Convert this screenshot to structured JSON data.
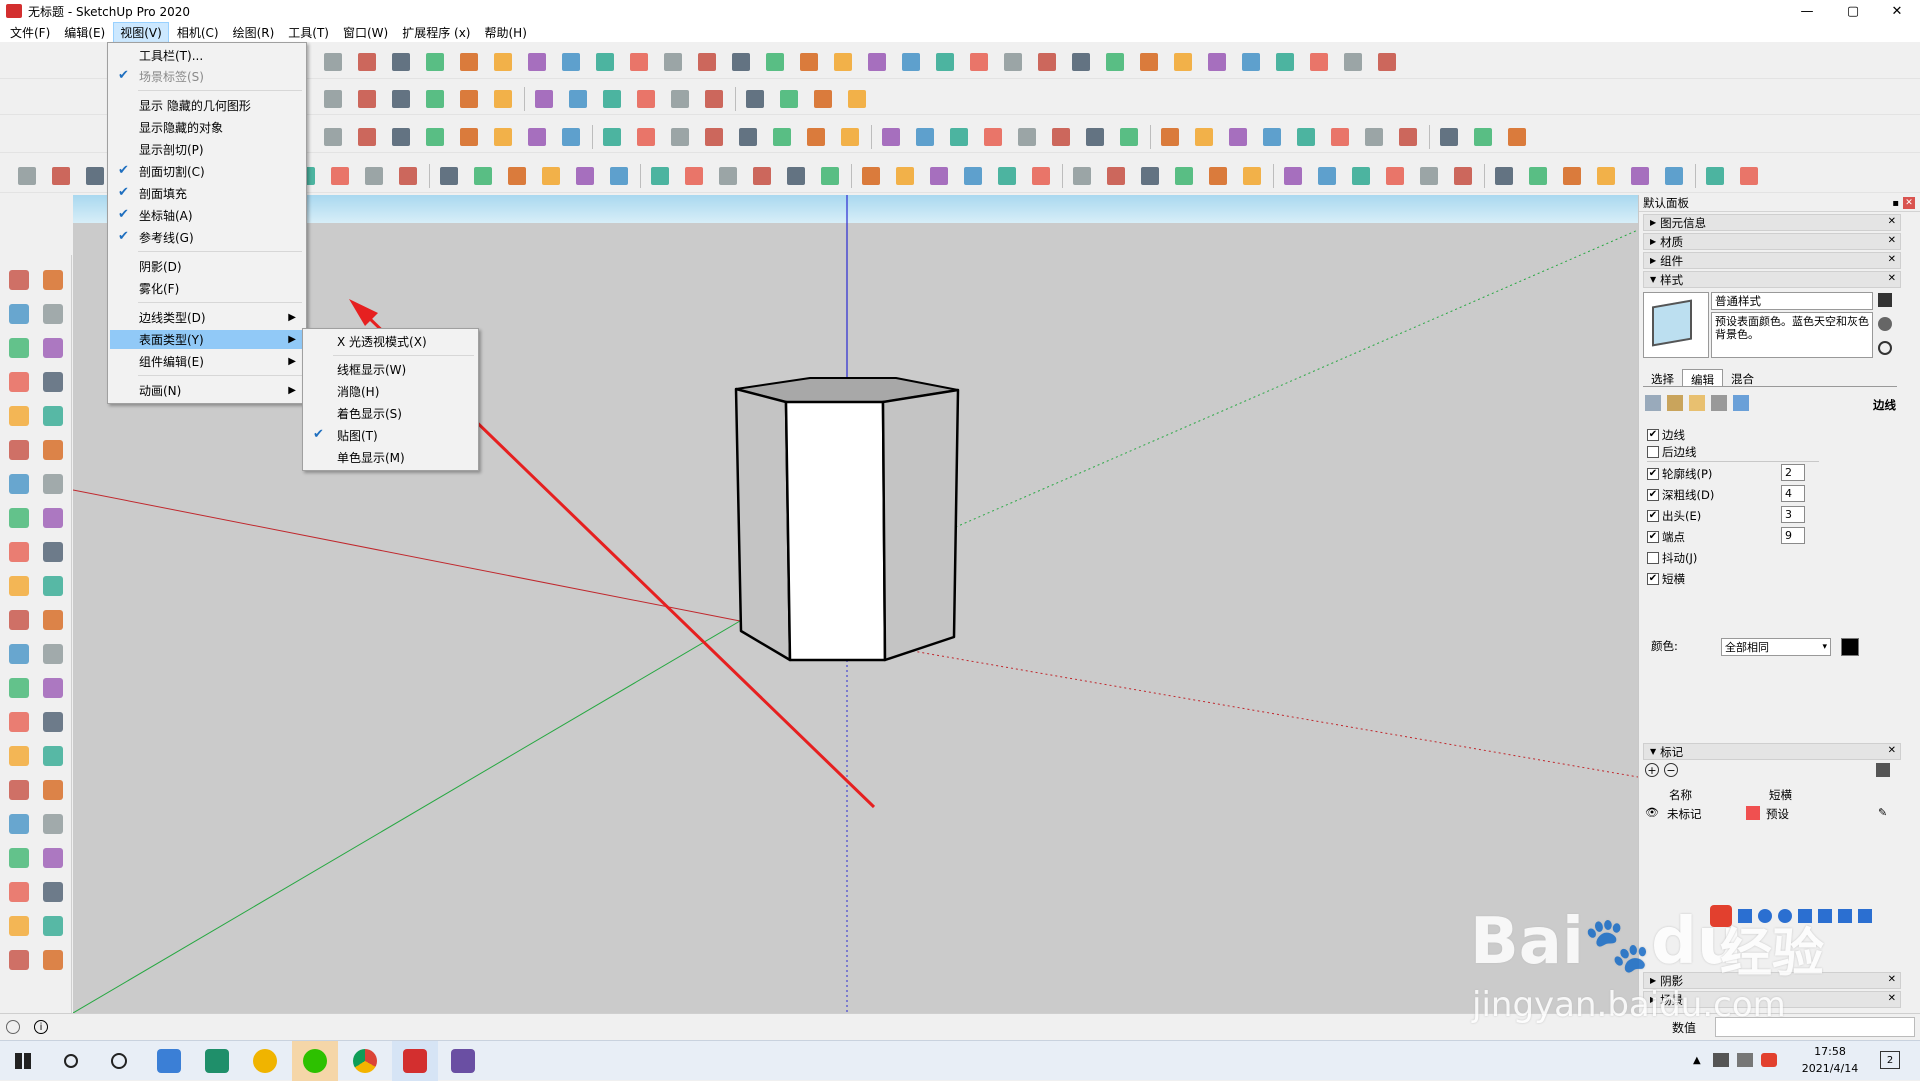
{
  "window": {
    "title": "无标题 - SketchUp Pro 2020",
    "minimize": "—",
    "maximize": "▢",
    "close": "✕"
  },
  "menubar": {
    "items": [
      "文件(F)",
      "编辑(E)",
      "视图(V)",
      "相机(C)",
      "绘图(R)",
      "工具(T)",
      "窗口(W)",
      "扩展程序 (x)",
      "帮助(H)"
    ]
  },
  "view_menu": {
    "items": [
      {
        "label": "工具栏(T)..."
      },
      {
        "label": "场景标签(S)",
        "checked": true,
        "disabled": true
      },
      {
        "label": "显示 隐藏的几何图形"
      },
      {
        "label": "显示隐藏的对象"
      },
      {
        "label": "显示剖切(P)"
      },
      {
        "label": "剖面切割(C)",
        "checked": true
      },
      {
        "label": "剖面填充",
        "checked": true
      },
      {
        "label": "坐标轴(A)",
        "checked": true
      },
      {
        "label": "参考线(G)",
        "checked": true
      },
      {
        "label": "阴影(D)"
      },
      {
        "label": "雾化(F)"
      },
      {
        "label": "边线类型(D)",
        "submenu": true
      },
      {
        "label": "表面类型(Y)",
        "submenu": true,
        "highlighted": true
      },
      {
        "label": "组件编辑(E)",
        "submenu": true
      },
      {
        "label": "动画(N)",
        "submenu": true
      }
    ]
  },
  "face_style_submenu": {
    "items": [
      {
        "label": "X 光透视模式(X)"
      },
      {
        "label": "线框显示(W)"
      },
      {
        "label": "消隐(H)"
      },
      {
        "label": "着色显示(S)"
      },
      {
        "label": "贴图(T)",
        "checked": true
      },
      {
        "label": "单色显示(M)"
      }
    ]
  },
  "tray": {
    "title": "默认面板",
    "panels": {
      "entity_info": "图元信息",
      "materials": "材质",
      "components": "组件",
      "styles": "样式"
    },
    "style_name": "普通样式",
    "style_desc": "预设表面颜色。蓝色天空和灰色背景色。",
    "tabs": [
      "选择",
      "编辑",
      "混合"
    ],
    "edge_heading": "边线",
    "edge_options": [
      {
        "label": "边线",
        "checked": true
      },
      {
        "label": "后边线",
        "checked": false
      },
      {
        "label": "轮廓线(P)",
        "checked": true,
        "value": "2"
      },
      {
        "label": "深粗线(D)",
        "checked": true,
        "value": "4"
      },
      {
        "label": "出头(E)",
        "checked": true,
        "value": "3"
      },
      {
        "label": "端点",
        "checked": true,
        "value": "9"
      },
      {
        "label": "抖动(J)",
        "checked": false
      },
      {
        "label": "短横",
        "checked": true
      }
    ],
    "color_label": "颜色:",
    "color_value": "全部相同",
    "color_swatch": "#000000",
    "tags": {
      "title": "标记",
      "col_name": "名称",
      "col_dash": "短横",
      "row_name": "未标记",
      "row_dash": "预设",
      "row_color": "#f05050"
    },
    "shadows": "阴影",
    "scenes": "场景"
  },
  "status": {
    "measure_label": "数值"
  },
  "taskbar": {
    "time": "17:58",
    "date": "2021/4/14",
    "notif": "2"
  },
  "watermark": {
    "brand": "Bai",
    "paw": "du",
    "cn": "经验",
    "url": "jingyan.baidu.com"
  },
  "colors": {
    "axis_red": "#c0282d",
    "axis_green": "#27a842",
    "axis_blue": "#2b2bd2",
    "sky": "#a9d8ef",
    "ground": "#cbcbcb",
    "highlight": "#91c9f7",
    "arrow": "#e62020"
  },
  "icons": [
    "select-icon",
    "eraser-icon",
    "paint-bucket-icon",
    "line-icon",
    "arc-icon",
    "rectangle-icon",
    "circle-icon",
    "push-pull-icon",
    "move-icon",
    "rotate-icon",
    "scale-icon",
    "tape-measure-icon",
    "text-icon",
    "orbit-icon",
    "pan-icon",
    "zoom-icon",
    "zoom-extents-icon",
    "walk-icon",
    "look-around-icon",
    "section-plane-icon",
    "3d-warehouse-icon"
  ]
}
